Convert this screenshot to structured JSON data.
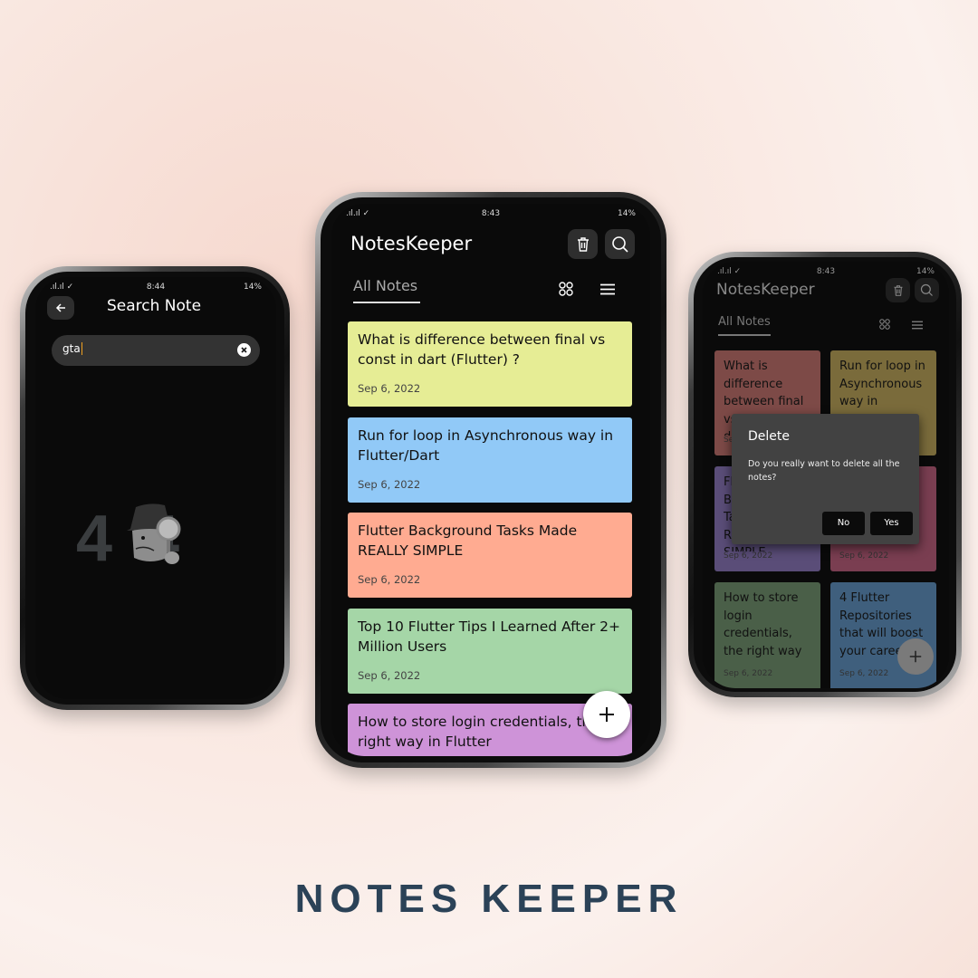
{
  "status_left": {
    "time": "8:44",
    "battery": "14%"
  },
  "status_center": {
    "time": "8:43",
    "battery": "14%"
  },
  "status_right": {
    "time": "8:43",
    "battery": "14%"
  },
  "search_screen": {
    "title": "Search Note",
    "query": "gta",
    "empty_text": "4  4",
    "icons": [
      "back-arrow-icon",
      "clear-icon"
    ]
  },
  "main_screen": {
    "app_title": "NotesKeeper",
    "tab": "All Notes",
    "icons": [
      "trash-icon",
      "search-icon",
      "grid-icon",
      "list-icon",
      "plus-icon"
    ],
    "notes": [
      {
        "title": "What is difference between final vs const in dart (Flutter) ?",
        "date": "Sep 6, 2022",
        "color": "#e6ed95"
      },
      {
        "title": "Run for loop in Asynchronous way in Flutter/Dart",
        "date": "Sep 6, 2022",
        "color": "#91c9f7"
      },
      {
        "title": "Flutter Background Tasks Made REALLY SIMPLE",
        "date": "Sep 6, 2022",
        "color": "#ffab91"
      },
      {
        "title": "Top 10 Flutter Tips I Learned After 2+ Million Users",
        "date": "Sep 6, 2022",
        "color": "#a5d6a7"
      },
      {
        "title": "How to store login credentials, the right way in Flutter",
        "date": "",
        "color": "#ce93d8"
      }
    ]
  },
  "grid_screen": {
    "app_title": "NotesKeeper",
    "tab": "All Notes",
    "notes": [
      {
        "title": "What is difference between final vs const in dart (Flutter) ?",
        "date": "Sep 6, 2022",
        "color": "#7d4a47"
      },
      {
        "title": "Run for loop in Asynchronous way in Flutter/Dart",
        "date": "Sep 6, 2022",
        "color": "#7a6b3b"
      },
      {
        "title": "Flutter Background Tasks Made REALLY SIMPLE",
        "date": "Sep 6, 2022",
        "color": "#5a4d78"
      },
      {
        "title": "",
        "date": "Sep 6, 2022",
        "color": "#7a3e51"
      },
      {
        "title": "How to store login credentials, the right way",
        "date": "Sep 6, 2022",
        "color": "#4a5f48"
      },
      {
        "title": "4 Flutter Repositories that will boost your career",
        "date": "Sep 6, 2022",
        "color": "#3f5f7d"
      }
    ],
    "dialog": {
      "title": "Delete",
      "message": "Do you really want to delete all the notes?",
      "no": "No",
      "yes": "Yes"
    }
  },
  "brand_heading": "NOTES KEEPER"
}
